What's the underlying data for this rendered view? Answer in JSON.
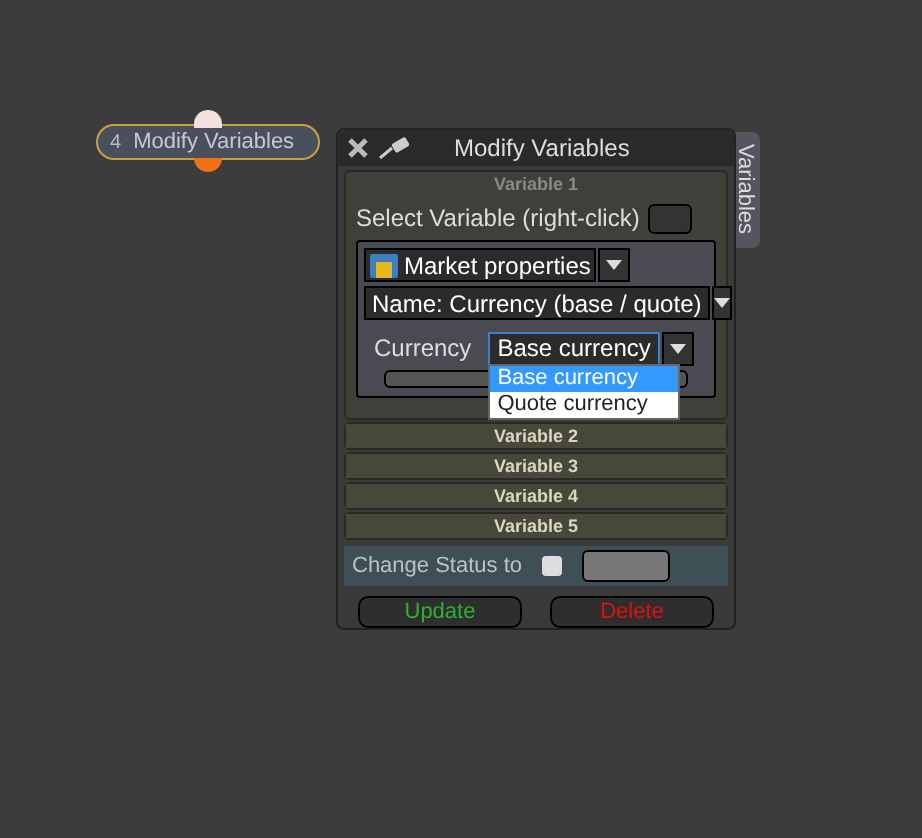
{
  "node": {
    "number": "4",
    "label": "Modify Variables"
  },
  "window": {
    "title": "Modify Variables",
    "side_tab": "Variables"
  },
  "variables": [
    {
      "label": "Variable 1",
      "expanded": true
    },
    {
      "label": "Variable 2",
      "expanded": false
    },
    {
      "label": "Variable 3",
      "expanded": false
    },
    {
      "label": "Variable 4",
      "expanded": false
    },
    {
      "label": "Variable 5",
      "expanded": false
    }
  ],
  "select_label": "Select Variable (right-click)",
  "category": "Market properties",
  "name_select": "Name: Currency (base / quote)",
  "currency": {
    "label": "Currency",
    "value": "Base currency",
    "expanded": true,
    "options": [
      {
        "label": "Base currency",
        "selected": true
      },
      {
        "label": "Quote currency",
        "selected": false
      }
    ]
  },
  "change_status": {
    "label": "Change Status to",
    "checked": false
  },
  "buttons": [
    {
      "label": "Update",
      "kind": "update"
    },
    {
      "label": "Delete",
      "kind": "delete"
    }
  ]
}
